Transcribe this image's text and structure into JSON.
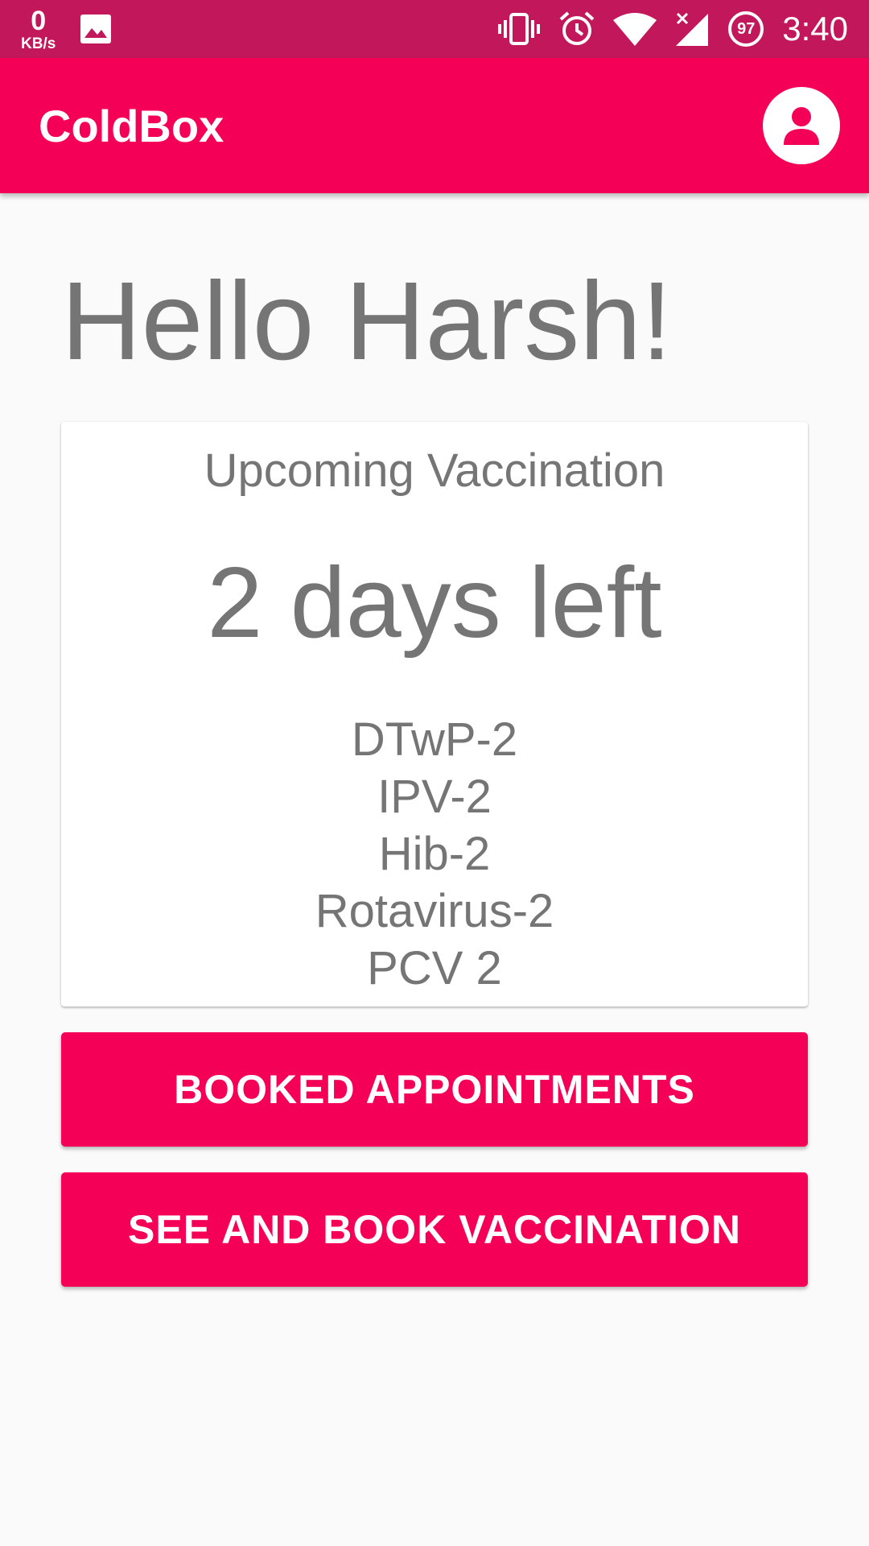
{
  "status_bar": {
    "net_speed_value": "0",
    "net_speed_unit": "KB/s",
    "battery_level": "97",
    "time": "3:40",
    "icons": [
      "image-icon",
      "vibrate-icon",
      "alarm-icon",
      "wifi-icon",
      "cell-signal-icon",
      "battery-icon"
    ]
  },
  "app_bar": {
    "title": "ColdBox",
    "profile_icon": "account-icon"
  },
  "main": {
    "greeting": "Hello Harsh!",
    "card": {
      "title": "Upcoming Vaccination",
      "countdown": "2 days left",
      "vaccines": [
        "DTwP-2",
        "IPV-2",
        "Hib-2",
        "Rotavirus-2",
        "PCV 2"
      ]
    },
    "buttons": {
      "booked_label": "BOOKED APPOINTMENTS",
      "book_label": "SEE AND BOOK VACCINATION"
    }
  },
  "colors": {
    "status_bar": "#c2185b",
    "app_bar": "#f50057",
    "button": "#f50057",
    "text_secondary": "#757575",
    "background": "#fafafa"
  }
}
